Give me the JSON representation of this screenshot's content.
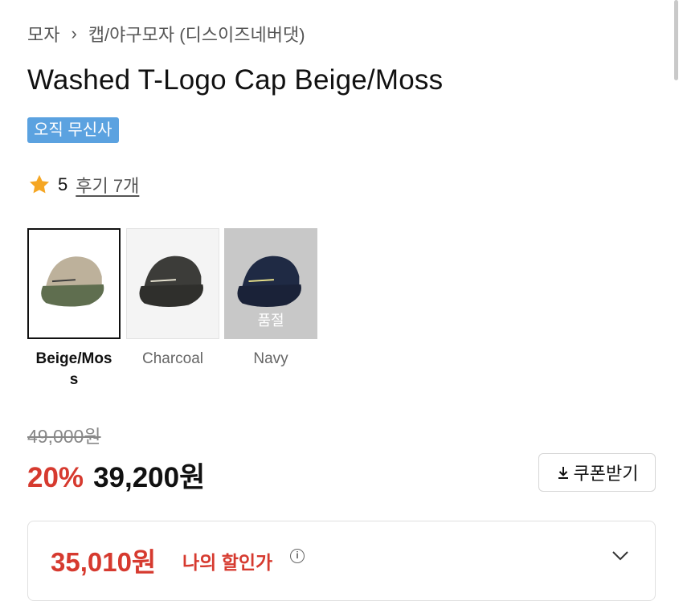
{
  "breadcrumb": {
    "root": "모자",
    "separator": "›",
    "category": "캡/야구모자 (디스이즈네버댓)"
  },
  "product": {
    "title": "Washed T-Logo Cap Beige/Moss",
    "badge": "오직 무신사",
    "rating": {
      "score": "5",
      "reviews_link": "후기 7개",
      "star_color": "#f5a623"
    }
  },
  "options": [
    {
      "label": "Beige/Mos s",
      "label_line1": "Beige/Mos",
      "label_line2": "s",
      "selected": true,
      "sold_out": false,
      "icon": "beige-moss-cap-image"
    },
    {
      "label": "Charcoal",
      "selected": false,
      "sold_out": false,
      "icon": "charcoal-cap-image"
    },
    {
      "label": "Navy",
      "selected": false,
      "sold_out": true,
      "sold_out_label": "품절",
      "icon": "navy-cap-image"
    }
  ],
  "pricing": {
    "original": "49,000원",
    "discount": "20%",
    "sale": "39,200원",
    "coupon_button": "쿠폰받기",
    "my_price": "35,010원",
    "my_price_label": "나의 할인가"
  },
  "colors": {
    "accent_red": "#d63a2f",
    "badge_blue": "#5ba2e0"
  }
}
